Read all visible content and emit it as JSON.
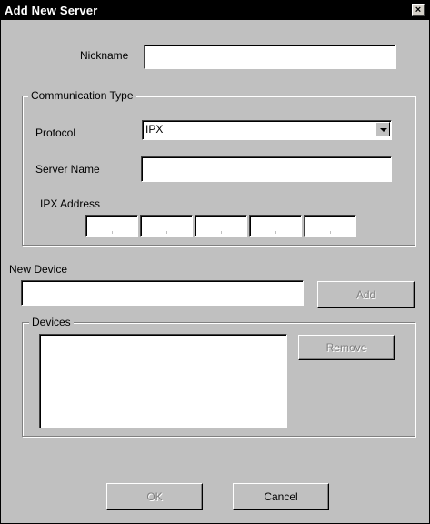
{
  "window": {
    "title": "Add New Server",
    "close_label": "×"
  },
  "nickname": {
    "label": "Nickname",
    "value": ""
  },
  "communication": {
    "legend": "Communication Type",
    "protocol_label": "Protocol",
    "protocol_value": "IPX",
    "server_name_label": "Server Name",
    "server_name_value": "",
    "ipx_address_label": "IPX Address",
    "ipx_segments": [
      "",
      "",
      "",
      "",
      ""
    ]
  },
  "new_device": {
    "label": "New Device",
    "value": "",
    "add_label": "Add"
  },
  "devices": {
    "legend": "Devices",
    "items": [],
    "remove_label": "Remove"
  },
  "footer": {
    "ok_label": "OK",
    "cancel_label": "Cancel"
  }
}
